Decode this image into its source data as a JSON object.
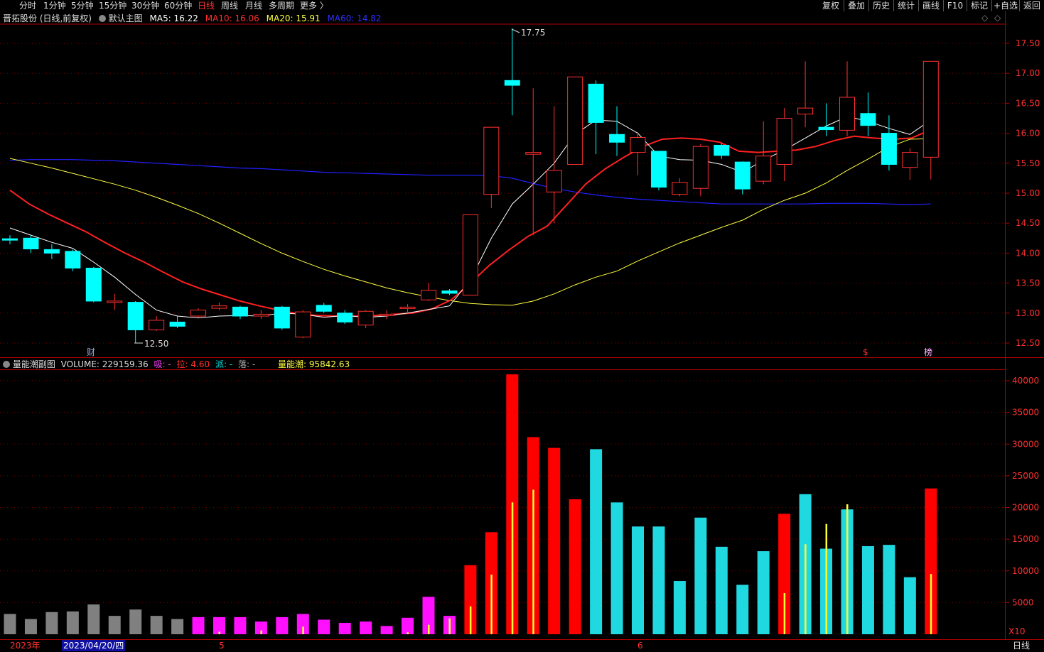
{
  "toolbar": {
    "periods": [
      "分时",
      "1分钟",
      "5分钟",
      "15分钟",
      "30分钟",
      "60分钟",
      "日线",
      "周线",
      "月线",
      "多周期",
      "更多 〉"
    ],
    "active_period": "日线",
    "right_buttons": [
      "复权",
      "叠加",
      "历史",
      "统计",
      "画线",
      "F10",
      "标记",
      "+自选",
      "返回"
    ]
  },
  "main_info": {
    "stock": "晋拓股份 (日线,前复权)",
    "indicator": "默认主图",
    "ma5": "MA5: 16.22",
    "ma10": "MA10: 16.06",
    "ma20": "MA20: 15.91",
    "ma60": "MA60: 14.82"
  },
  "sub_info": {
    "name": "量能潮副图",
    "volume": "VOLUME: 229159.36",
    "xi": "吸: -",
    "la": "拉: 4.60",
    "pai": "派: -",
    "luo": "落: -",
    "lnc": "量能潮: 95842.63"
  },
  "markers": {
    "high": "17.75",
    "low": "12.50",
    "cai": "财",
    "s": "$",
    "bang": "榜"
  },
  "price_axis": [
    "17.50",
    "17.00",
    "16.50",
    "16.00",
    "15.50",
    "15.00",
    "14.50",
    "14.00",
    "13.50",
    "13.00",
    "12.50"
  ],
  "volume_axis": [
    "40000",
    "35000",
    "30000",
    "25000",
    "20000",
    "15000",
    "10000",
    "5000"
  ],
  "volume_unit": "X10",
  "bottom": {
    "year": "2023年",
    "date": "2023/04/20/四",
    "month5": "5",
    "month6": "6",
    "period": "日线"
  },
  "colors": {
    "up": "#ff3030",
    "down": "#00ffff",
    "ma5": "#ffffff",
    "ma10": "#ff2020",
    "ma20": "#ffff40",
    "ma60": "#2020ff"
  },
  "chart_data": {
    "type": "candlestick",
    "price_range": [
      12.3,
      17.85
    ],
    "volume_range": [
      0,
      42000
    ],
    "candles": [
      {
        "o": 14.24,
        "c": 14.22,
        "h": 14.3,
        "l": 14.15
      },
      {
        "o": 14.25,
        "c": 14.07,
        "h": 14.3,
        "l": 14.0
      },
      {
        "o": 14.06,
        "c": 14.0,
        "h": 14.15,
        "l": 13.9
      },
      {
        "o": 14.03,
        "c": 13.75,
        "h": 14.06,
        "l": 13.7
      },
      {
        "o": 13.75,
        "c": 13.2,
        "h": 13.77,
        "l": 13.18
      },
      {
        "o": 13.2,
        "c": 13.2,
        "h": 13.32,
        "l": 13.05
      },
      {
        "o": 13.18,
        "c": 12.72,
        "h": 13.2,
        "l": 12.5
      },
      {
        "o": 12.72,
        "c": 12.88,
        "h": 12.95,
        "l": 12.7
      },
      {
        "o": 12.85,
        "c": 12.78,
        "h": 12.95,
        "l": 12.75
      },
      {
        "o": 12.95,
        "c": 13.05,
        "h": 13.08,
        "l": 12.92
      },
      {
        "o": 13.08,
        "c": 13.12,
        "h": 13.18,
        "l": 13.05
      },
      {
        "o": 13.1,
        "c": 12.95,
        "h": 13.12,
        "l": 12.9
      },
      {
        "o": 12.95,
        "c": 12.98,
        "h": 13.05,
        "l": 12.9
      },
      {
        "o": 13.1,
        "c": 12.75,
        "h": 13.12,
        "l": 12.72
      },
      {
        "o": 12.6,
        "c": 13.02,
        "h": 13.05,
        "l": 12.58
      },
      {
        "o": 13.13,
        "c": 13.03,
        "h": 13.17,
        "l": 13.0
      },
      {
        "o": 13.0,
        "c": 12.85,
        "h": 13.05,
        "l": 12.82
      },
      {
        "o": 12.8,
        "c": 13.03,
        "h": 13.05,
        "l": 12.75
      },
      {
        "o": 12.98,
        "c": 12.98,
        "h": 13.05,
        "l": 12.9
      },
      {
        "o": 13.08,
        "c": 13.1,
        "h": 13.15,
        "l": 13.0
      },
      {
        "o": 13.22,
        "c": 13.38,
        "h": 13.5,
        "l": 13.2
      },
      {
        "o": 13.37,
        "c": 13.33,
        "h": 13.4,
        "l": 13.3
      },
      {
        "o": 13.3,
        "c": 14.64,
        "h": 14.64,
        "l": 13.3
      },
      {
        "o": 14.98,
        "c": 16.1,
        "h": 16.1,
        "l": 14.75
      },
      {
        "o": 16.88,
        "c": 16.8,
        "h": 17.75,
        "l": 16.3
      },
      {
        "o": 15.65,
        "c": 15.68,
        "h": 16.75,
        "l": 14.3
      },
      {
        "o": 15.02,
        "c": 15.38,
        "h": 16.45,
        "l": 14.5
      },
      {
        "o": 15.48,
        "c": 16.94,
        "h": 16.94,
        "l": 15.48
      },
      {
        "o": 16.82,
        "c": 16.18,
        "h": 16.88,
        "l": 15.65
      },
      {
        "o": 15.98,
        "c": 15.85,
        "h": 16.45,
        "l": 15.62
      },
      {
        "o": 15.68,
        "c": 15.93,
        "h": 16.02,
        "l": 15.3
      },
      {
        "o": 15.7,
        "c": 15.1,
        "h": 15.7,
        "l": 15.05
      },
      {
        "o": 14.98,
        "c": 15.18,
        "h": 15.25,
        "l": 14.95
      },
      {
        "o": 15.08,
        "c": 15.78,
        "h": 15.82,
        "l": 14.95
      },
      {
        "o": 15.8,
        "c": 15.63,
        "h": 15.83,
        "l": 15.57
      },
      {
        "o": 15.52,
        "c": 15.07,
        "h": 15.53,
        "l": 14.98
      },
      {
        "o": 15.2,
        "c": 15.62,
        "h": 16.2,
        "l": 15.15
      },
      {
        "o": 15.48,
        "c": 16.25,
        "h": 16.42,
        "l": 15.2
      },
      {
        "o": 16.32,
        "c": 16.42,
        "h": 17.2,
        "l": 16.1
      },
      {
        "o": 16.1,
        "c": 16.06,
        "h": 16.5,
        "l": 15.95
      },
      {
        "o": 16.05,
        "c": 16.6,
        "h": 17.2,
        "l": 15.95
      },
      {
        "o": 16.33,
        "c": 16.13,
        "h": 16.68,
        "l": 15.95
      },
      {
        "o": 16.0,
        "c": 15.48,
        "h": 16.3,
        "l": 15.38
      },
      {
        "o": 15.43,
        "c": 15.68,
        "h": 15.75,
        "l": 15.22
      },
      {
        "o": 15.6,
        "c": 17.2,
        "h": 17.2,
        "l": 15.23
      }
    ],
    "ma5": [
      14.42,
      14.3,
      14.18,
      14.08,
      13.85,
      13.6,
      13.31,
      13.05,
      12.95,
      12.92,
      12.95,
      12.96,
      12.95,
      13.0,
      12.98,
      12.93,
      12.96,
      12.93,
      12.95,
      13.0,
      13.06,
      13.12,
      13.55,
      14.25,
      14.82,
      15.15,
      15.5,
      15.98,
      16.22,
      16.2,
      16.0,
      15.62,
      15.56,
      15.55,
      15.48,
      15.35,
      15.55,
      15.72,
      15.92,
      16.12,
      16.28,
      16.2,
      16.08,
      15.98,
      16.22
    ],
    "ma10": [
      15.05,
      14.82,
      14.65,
      14.5,
      14.35,
      14.17,
      14.0,
      13.85,
      13.68,
      13.52,
      13.4,
      13.3,
      13.2,
      13.12,
      13.05,
      12.99,
      12.96,
      12.95,
      12.95,
      12.96,
      12.98,
      13.0,
      13.07,
      13.22,
      13.5,
      13.8,
      14.05,
      14.28,
      14.45,
      14.8,
      15.15,
      15.4,
      15.6,
      15.78,
      15.9,
      15.92,
      15.9,
      15.85,
      15.7,
      15.68,
      15.7,
      15.72,
      15.78,
      15.88,
      15.95,
      15.92,
      15.9,
      15.92,
      16.06
    ],
    "ma20": [
      15.58,
      15.5,
      15.42,
      15.33,
      15.24,
      15.15,
      15.05,
      14.93,
      14.8,
      14.66,
      14.5,
      14.33,
      14.16,
      14.0,
      13.86,
      13.73,
      13.62,
      13.52,
      13.42,
      13.34,
      13.27,
      13.21,
      13.16,
      13.14,
      13.13,
      13.2,
      13.32,
      13.47,
      13.6,
      13.7,
      13.87,
      14.02,
      14.17,
      14.3,
      14.43,
      14.55,
      14.73,
      14.88,
      15.0,
      15.17,
      15.38,
      15.57,
      15.77,
      15.9,
      15.91
    ],
    "ma60": [
      15.55,
      15.56,
      15.56,
      15.56,
      15.55,
      15.54,
      15.52,
      15.5,
      15.48,
      15.46,
      15.44,
      15.42,
      15.41,
      15.39,
      15.37,
      15.35,
      15.34,
      15.33,
      15.32,
      15.31,
      15.3,
      15.3,
      15.3,
      15.29,
      15.25,
      15.16,
      15.08,
      15.02,
      14.97,
      14.93,
      14.9,
      14.88,
      14.86,
      14.84,
      14.82,
      14.82,
      14.82,
      14.82,
      14.82,
      14.83,
      14.83,
      14.83,
      14.82,
      14.81,
      14.82
    ],
    "volumes": [
      3200,
      2400,
      3500,
      3600,
      4700,
      2900,
      3900,
      2900,
      2400,
      2700,
      2700,
      2700,
      2000,
      2700,
      3200,
      2300,
      1800,
      2000,
      1300,
      2600,
      5900,
      2900,
      10900,
      16100,
      41000,
      31100,
      29400,
      21300,
      29200,
      20800,
      17000,
      17000,
      8400,
      18400,
      13800,
      7800,
      13100,
      19000,
      22100,
      13500,
      19700,
      13900,
      14100,
      9000,
      23000
    ],
    "vol_colors": [
      "g",
      "g",
      "g",
      "g",
      "g",
      "g",
      "g",
      "g",
      "g",
      "m",
      "m",
      "m",
      "m",
      "m",
      "m",
      "m",
      "m",
      "m",
      "m",
      "m",
      "m",
      "m",
      "r",
      "r",
      "r",
      "r",
      "r",
      "r",
      "c",
      "c",
      "c",
      "c",
      "c",
      "c",
      "c",
      "c",
      "c",
      "r",
      "c",
      "c",
      "c",
      "c",
      "c",
      "c",
      "r"
    ],
    "yellow_lines": [
      0,
      0,
      0,
      0,
      0,
      0,
      0,
      0,
      0,
      0,
      400,
      0,
      600,
      0,
      1200,
      0,
      0,
      0,
      0,
      300,
      1500,
      2500,
      4400,
      9400,
      20800,
      22800,
      0,
      0,
      0,
      0,
      0,
      0,
      0,
      0,
      0,
      0,
      0,
      6500,
      14200,
      17400,
      20500,
      0,
      0,
      0,
      9500
    ]
  }
}
